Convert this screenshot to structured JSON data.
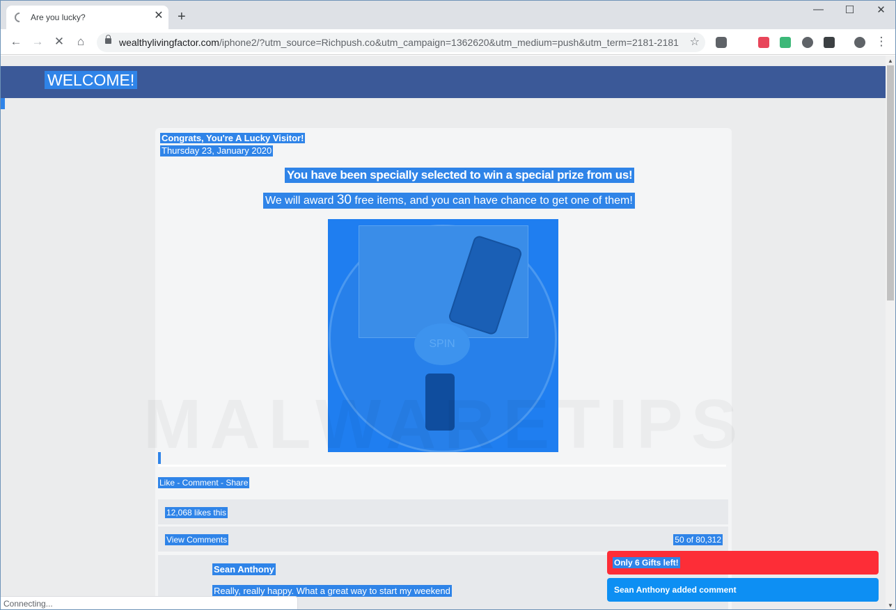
{
  "browser": {
    "tab_title": "Are you lucky?",
    "tab_close": "✕",
    "new_tab": "+",
    "url_host": "wealthylivingfactor.com",
    "url_path": "/iphone2/?utm_source=Richpush.co&utm_campaign=1362620&utm_medium=push&utm_term=2181-2181...",
    "status_text": "Connecting..."
  },
  "page": {
    "welcome": "WELCOME!",
    "congrats": "Congrats, You're A Lucky Visitor!",
    "date": "Thursday 23, January 2020",
    "selected": "You have been specially selected to win a special prize from us!",
    "award_prefix": "We will award ",
    "award_number": "30",
    "award_suffix": " free items, and you can have chance to get one of them!",
    "spin_label": "SPIN",
    "like_comment_share": "Like - Comment - Share",
    "likes": "12,068 likes this",
    "view_comments": "View Comments",
    "comment_count": "50 of 80,312",
    "comment_name": "Sean Anthony",
    "comment_text": "Really, really happy. What a great way to start my weekend",
    "watermark": "MALWARETIPS"
  },
  "notifications": {
    "gifts_left": "Only 6 Gifts left!",
    "added_comment": "Sean Anthony added comment"
  },
  "colors": {
    "header": "#3b5998",
    "highlight": "#2f84e8",
    "notice_red": "#fd2d37",
    "notice_blue": "#0d8ff3"
  }
}
